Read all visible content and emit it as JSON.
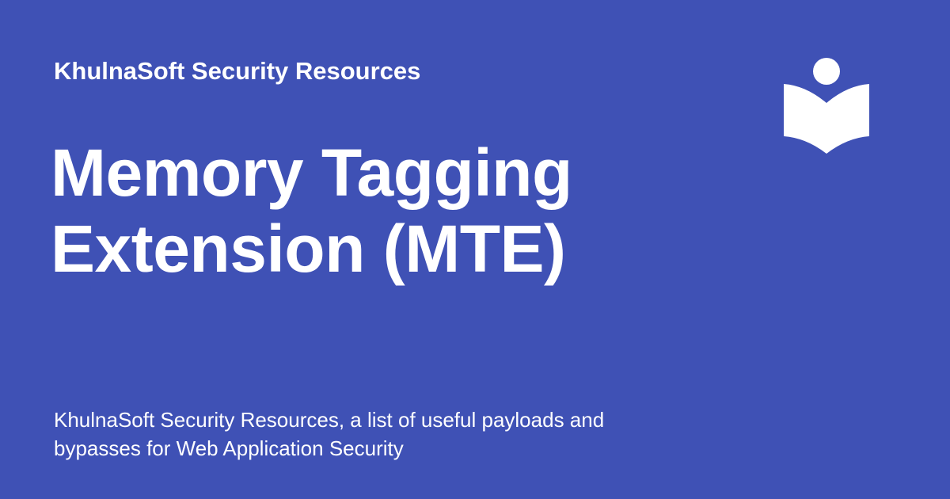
{
  "theme": {
    "background": "#3f51b5",
    "text": "#ffffff"
  },
  "header": {
    "site_name": "KhulnaSoft Security Resources"
  },
  "title": {
    "line1": "Memory Tagging",
    "line2": "Extension (MTE)"
  },
  "description": {
    "line1": "KhulnaSoft Security Resources, a list of useful payloads and",
    "line2": "bypasses for Web Application Security"
  },
  "logo": {
    "icon": "reader-book-icon"
  }
}
